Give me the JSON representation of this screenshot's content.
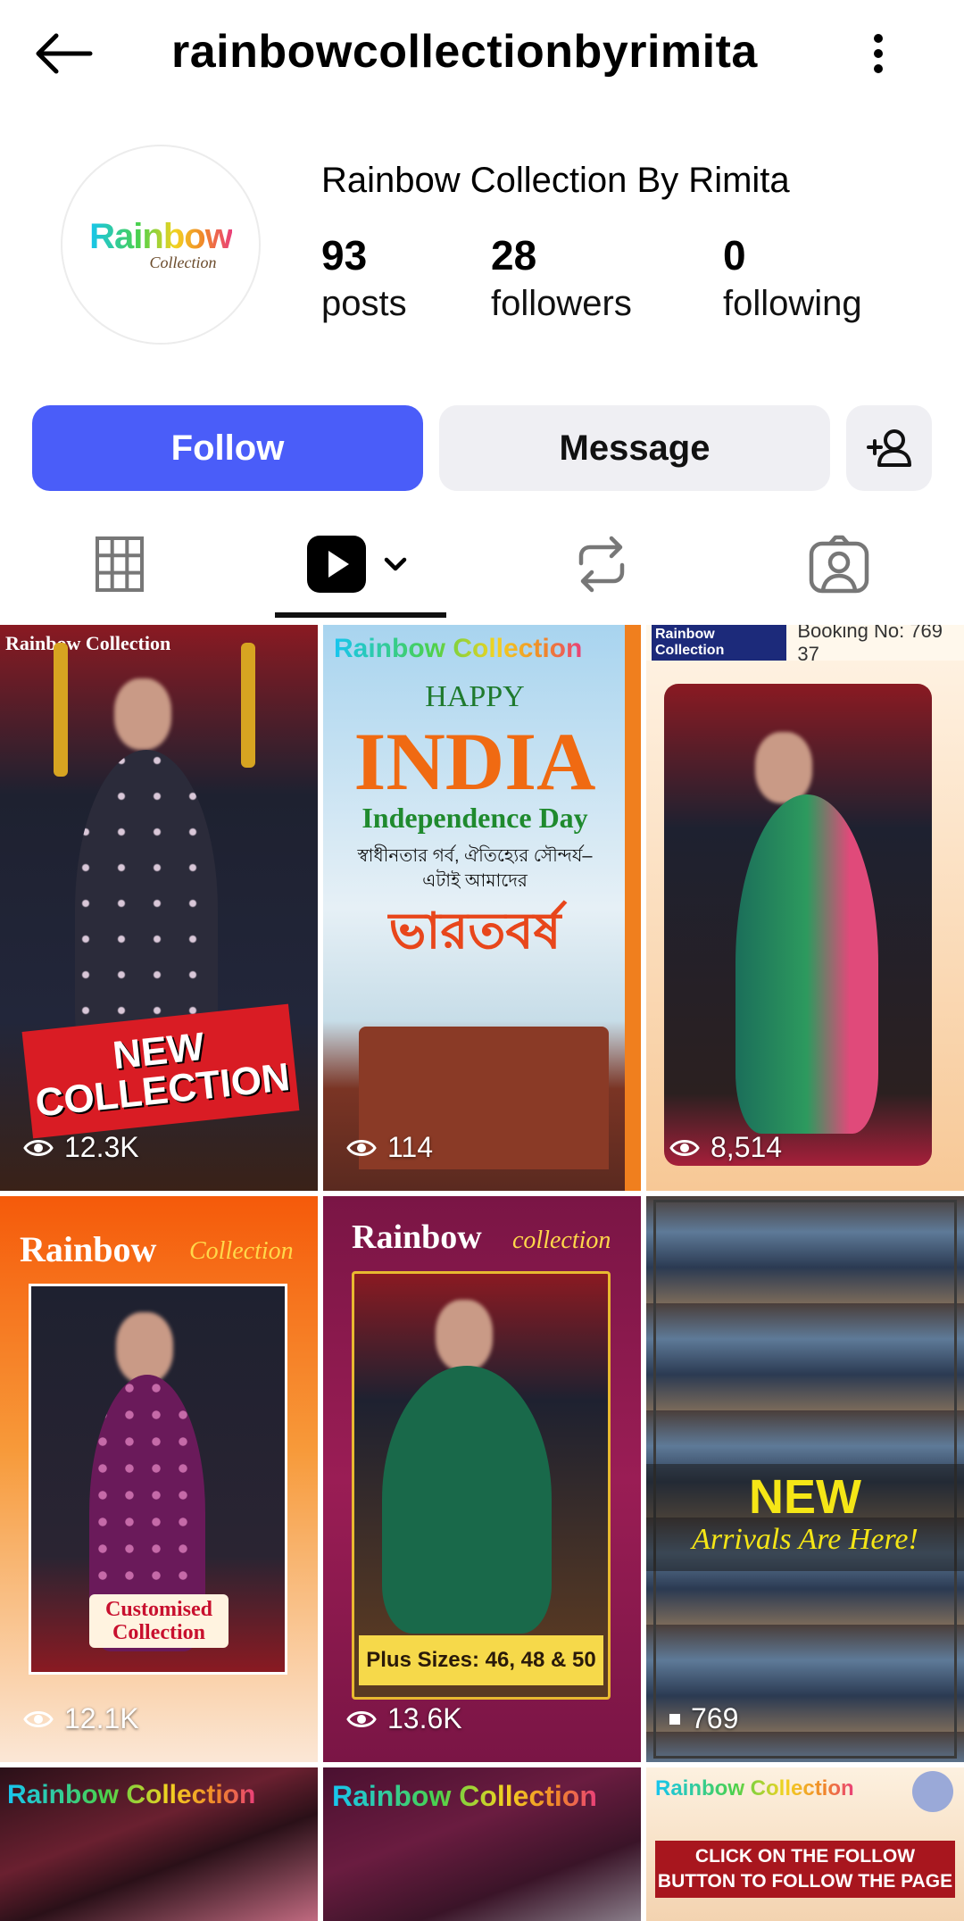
{
  "header": {
    "username": "rainbowcollectionbyrimita",
    "back_icon": "arrow-left-icon",
    "more_icon": "more-vertical-icon"
  },
  "profile": {
    "avatar_logo_text": "Rainbow",
    "avatar_logo_sub": "Collection",
    "display_name": "Rainbow Collection By Rimita",
    "stats": [
      {
        "value": "93",
        "label": "posts"
      },
      {
        "value": "28",
        "label": "followers"
      },
      {
        "value": "0",
        "label": "following"
      }
    ]
  },
  "actions": {
    "follow_label": "Follow",
    "message_label": "Message",
    "add_icon": "add-person-icon"
  },
  "tabs": {
    "items": [
      "grid-icon",
      "reels-icon",
      "reposts-icon",
      "tagged-icon"
    ],
    "active": "reels-icon"
  },
  "colors": {
    "follow_bg": "#4a5df9",
    "secondary_bg": "#efeff3"
  },
  "reels": [
    {
      "views": "12.3K",
      "overlay": "NEW COLLECTION",
      "badge": "Rainbow Collection"
    },
    {
      "views": "114",
      "badge": "Rainbow Collection",
      "line1": "HAPPY",
      "line2": "INDIA",
      "line3": "Independence Day",
      "line4": "স্বাধীনতার গর্ব, ঐতিহ্যের সৌন্দর্য–",
      "line5": "এটাই আমাদের",
      "line6": "ভারতবর্ষ"
    },
    {
      "views": "8,514",
      "badge": "Rainbow Collection",
      "booking": "Booking No: 769        37"
    },
    {
      "views": "12.1K",
      "title": "Rainbow",
      "title2": "Collection",
      "banner": "Customised Collection"
    },
    {
      "views": "13.6K",
      "title": "Rainbow",
      "title2": "collection",
      "banner": "Plus Sizes: 46, 48 & 50"
    },
    {
      "views": "769",
      "line1": "NEW",
      "line2": "Arrivals Are Here!"
    },
    {
      "badge": "Rainbow Collection"
    },
    {
      "badge": "Rainbow Collection"
    },
    {
      "badge": "Rainbow Collection",
      "banner": "CLICK ON THE FOLLOW BUTTON TO FOLLOW THE PAGE"
    }
  ]
}
